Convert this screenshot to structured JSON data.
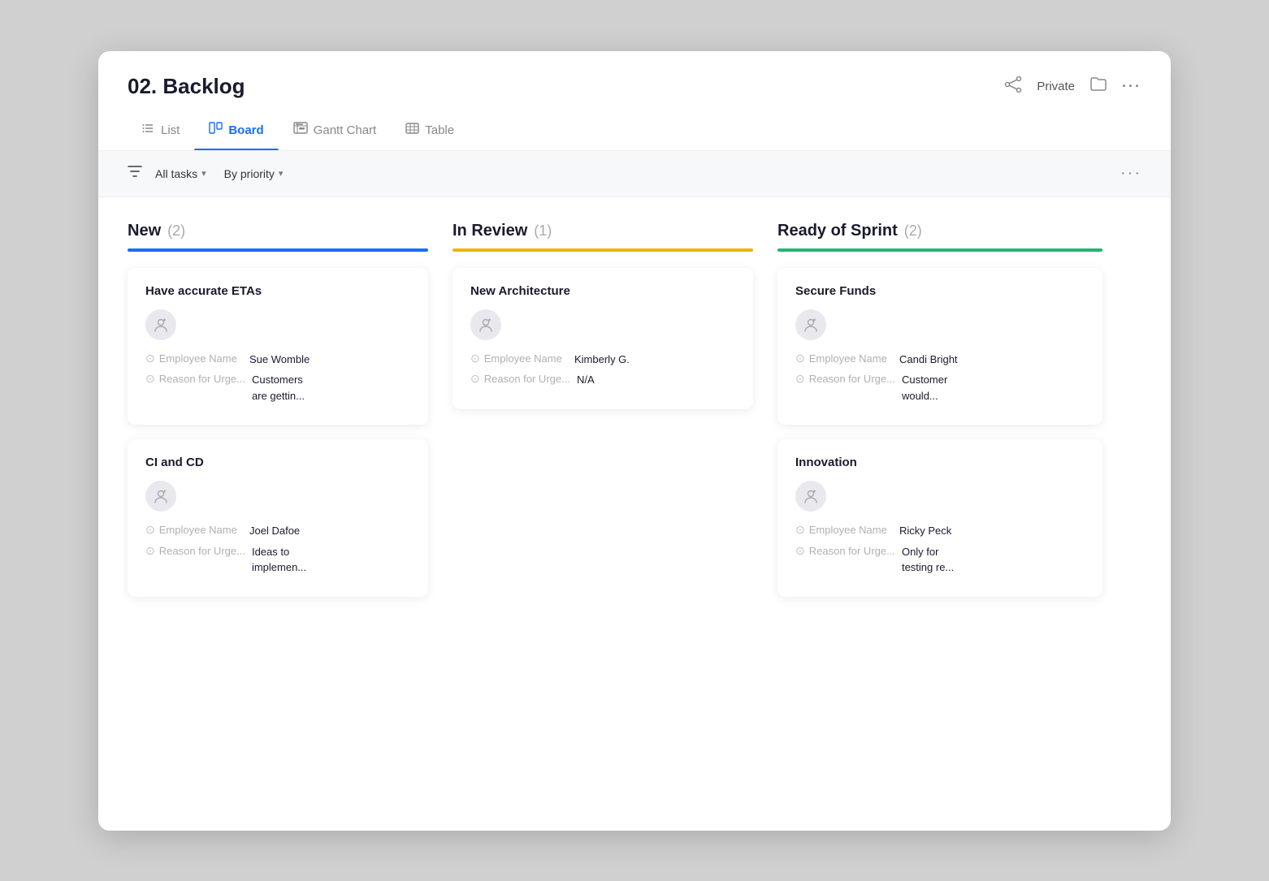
{
  "window": {
    "title": "02. Backlog"
  },
  "header": {
    "title": "02. Backlog",
    "private_label": "Private",
    "icons": {
      "share": "⎋",
      "folder": "🗂",
      "more": "···"
    }
  },
  "tabs": [
    {
      "id": "list",
      "label": "List",
      "icon": "≡",
      "active": false
    },
    {
      "id": "board",
      "label": "Board",
      "icon": "⊞",
      "active": true
    },
    {
      "id": "gantt",
      "label": "Gantt Chart",
      "icon": "⊟",
      "active": false
    },
    {
      "id": "table",
      "label": "Table",
      "icon": "⊞",
      "active": false
    }
  ],
  "toolbar": {
    "filter_label": "All tasks",
    "group_label": "By priority",
    "more": "···"
  },
  "columns": [
    {
      "id": "new",
      "title": "New",
      "count": "(2)",
      "bar_color": "bar-blue",
      "cards": [
        {
          "id": "card1",
          "title": "Have accurate ETAs",
          "fields": [
            {
              "label": "Employee Name",
              "value": "Sue Womble"
            },
            {
              "label": "Reason for Urge...",
              "value": "Customers are gettin..."
            }
          ]
        },
        {
          "id": "card2",
          "title": "CI and CD",
          "fields": [
            {
              "label": "Employee Name",
              "value": "Joel Dafoe"
            },
            {
              "label": "Reason for Urge...",
              "value": "Ideas to implemen..."
            }
          ]
        }
      ]
    },
    {
      "id": "in-review",
      "title": "In Review",
      "count": "(1)",
      "bar_color": "bar-yellow",
      "cards": [
        {
          "id": "card3",
          "title": "New Architecture",
          "fields": [
            {
              "label": "Employee Name",
              "value": "Kimberly G."
            },
            {
              "label": "Reason for Urge...",
              "value": "N/A"
            }
          ]
        }
      ]
    },
    {
      "id": "ready-sprint",
      "title": "Ready of Sprint",
      "count": "(2)",
      "bar_color": "bar-green",
      "cards": [
        {
          "id": "card4",
          "title": "Secure Funds",
          "fields": [
            {
              "label": "Employee Name",
              "value": "Candi Bright"
            },
            {
              "label": "Reason for Urge...",
              "value": "Customer would..."
            }
          ]
        },
        {
          "id": "card5",
          "title": "Innovation",
          "fields": [
            {
              "label": "Employee Name",
              "value": "Ricky Peck"
            },
            {
              "label": "Reason for Urge...",
              "value": "Only for testing re..."
            }
          ]
        }
      ]
    }
  ]
}
